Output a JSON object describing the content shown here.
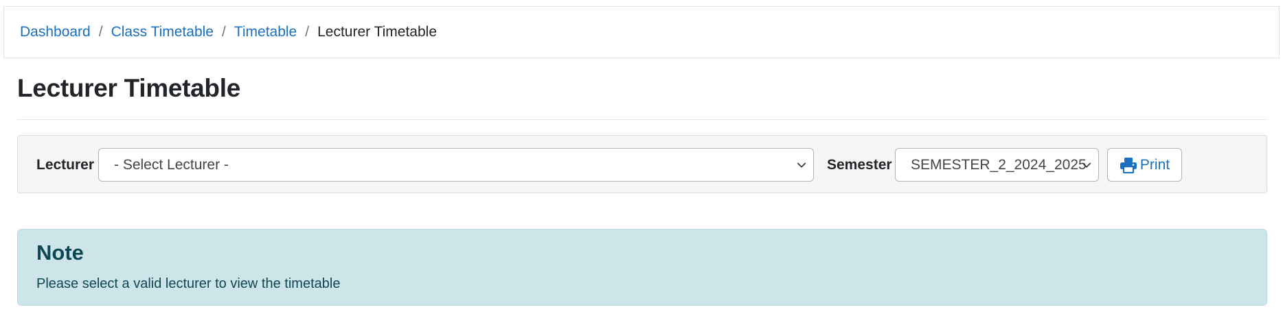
{
  "breadcrumb": {
    "items": [
      {
        "label": "Dashboard"
      },
      {
        "label": "Class Timetable"
      },
      {
        "label": "Timetable"
      }
    ],
    "separator": "/",
    "current": "Lecturer Timetable"
  },
  "page": {
    "title": "Lecturer Timetable"
  },
  "filters": {
    "lecturer_label": "Lecturer",
    "lecturer_value": "- Select Lecturer -",
    "semester_label": "Semester",
    "semester_value": "SEMESTER_2_2024_2025",
    "print_label": "Print",
    "print_icon": "printer-icon"
  },
  "note": {
    "title": "Note",
    "text": "Please select a valid lecturer to view the timetable"
  },
  "colors": {
    "link": "#1a6fbf",
    "note_bg": "#cde5e8",
    "note_text": "#0d4653"
  }
}
